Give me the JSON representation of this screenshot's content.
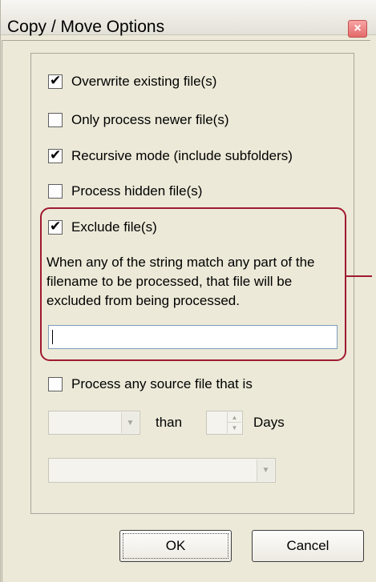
{
  "window": {
    "title": "Copy / Move Options",
    "close_glyph": "×",
    "accent_color": "#a01a30"
  },
  "options": [
    {
      "label": "Overwrite existing file(s)",
      "checked": true
    },
    {
      "label": "Only process newer file(s)",
      "checked": false
    },
    {
      "label": "Recursive mode (include subfolders)",
      "checked": true
    },
    {
      "label": "Process hidden file(s)",
      "checked": false
    },
    {
      "label": "Exclude file(s)",
      "checked": true
    }
  ],
  "exclude": {
    "description": "When any of the string match any part of the filename to be processed, that file will be excluded from being processed.",
    "value": ""
  },
  "age_filter": {
    "label": "Process any source file that is",
    "checked": false,
    "comparison_value": "",
    "than_label": "than",
    "days_value": "",
    "days_label": "Days",
    "date_type_value": ""
  },
  "buttons": {
    "ok": "OK",
    "cancel": "Cancel"
  },
  "icons": {
    "check": "✔",
    "dropdown": "▼",
    "spin_up": "▲",
    "spin_down": "▼"
  }
}
